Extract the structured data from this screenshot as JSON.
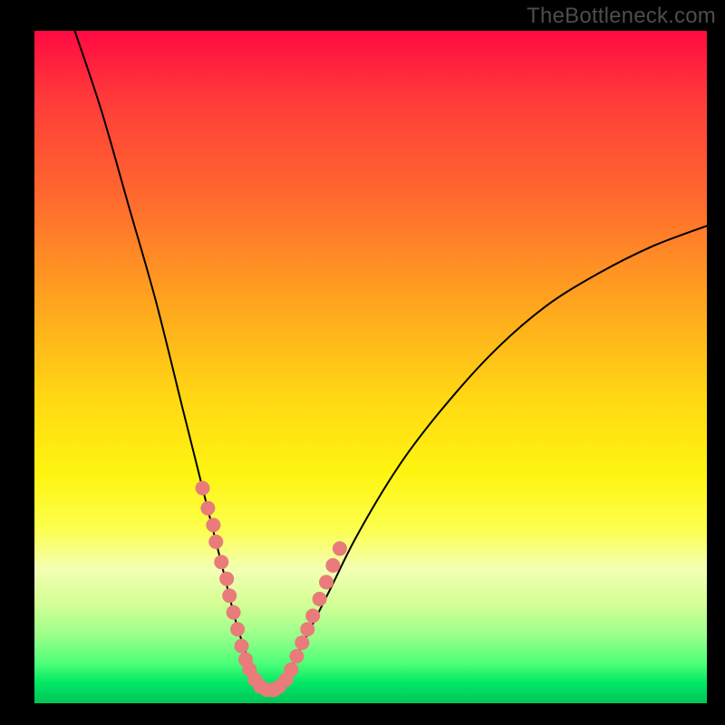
{
  "watermark": "TheBottleneck.com",
  "chart_data": {
    "type": "line",
    "title": "",
    "xlabel": "",
    "ylabel": "",
    "xlim": [
      0,
      100
    ],
    "ylim": [
      0,
      100
    ],
    "note": "Unlabeled bottleneck curve over a vertical red-to-green gradient. The black curve resembles |value - optimum| with an asymmetric V, minimum near x≈34. Salmon dots highlight the lower portion of the curve near the green optimal band.",
    "series": [
      {
        "name": "bottleneck-curve",
        "color": "#000000",
        "x": [
          6,
          10,
          14,
          18,
          22,
          24,
          26,
          28,
          30,
          32,
          34,
          36,
          38,
          40,
          44,
          48,
          54,
          60,
          68,
          76,
          84,
          92,
          100
        ],
        "y": [
          100,
          88,
          74,
          60,
          44,
          36,
          28,
          20,
          12,
          6,
          2,
          2,
          5,
          9,
          17,
          25,
          35,
          43,
          52,
          59,
          64,
          68,
          71
        ]
      }
    ],
    "highlight_points": {
      "name": "near-optimum-samples",
      "color": "#e97b7b",
      "x": [
        25.0,
        25.8,
        26.6,
        27.0,
        27.8,
        28.6,
        29.0,
        29.6,
        30.2,
        30.8,
        31.4,
        32.0,
        32.8,
        33.6,
        34.6,
        35.6,
        36.4,
        37.4,
        38.2,
        39.0,
        39.8,
        40.6,
        41.4,
        42.4,
        43.4,
        44.4,
        45.4
      ],
      "y": [
        32.0,
        29.0,
        26.5,
        24.0,
        21.0,
        18.5,
        16.0,
        13.5,
        11.0,
        8.5,
        6.5,
        5.0,
        3.5,
        2.5,
        2.0,
        2.0,
        2.5,
        3.5,
        5.0,
        7.0,
        9.0,
        11.0,
        13.0,
        15.5,
        18.0,
        20.5,
        23.0
      ]
    },
    "gradient_stops": [
      {
        "pct": 0,
        "color": "#ff0a42"
      },
      {
        "pct": 10,
        "color": "#ff3a3a"
      },
      {
        "pct": 25,
        "color": "#ff6a2e"
      },
      {
        "pct": 40,
        "color": "#ffa31f"
      },
      {
        "pct": 55,
        "color": "#ffd913"
      },
      {
        "pct": 66,
        "color": "#fff511"
      },
      {
        "pct": 74,
        "color": "#fcff4d"
      },
      {
        "pct": 80,
        "color": "#f3ffb3"
      },
      {
        "pct": 85,
        "color": "#d6ff96"
      },
      {
        "pct": 90,
        "color": "#99ff8a"
      },
      {
        "pct": 94,
        "color": "#4fff78"
      },
      {
        "pct": 97,
        "color": "#01e765"
      },
      {
        "pct": 100,
        "color": "#00c657"
      }
    ]
  }
}
